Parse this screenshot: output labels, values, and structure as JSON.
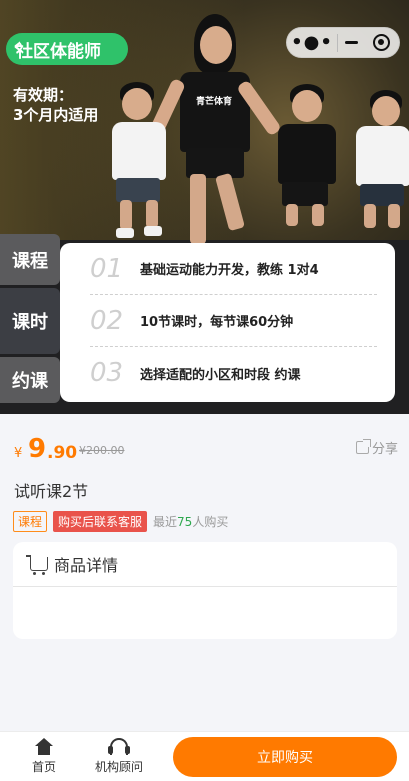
{
  "header": {
    "title": "社区体能师",
    "validity_line1": "有效期：",
    "validity_line2": "3个月内适用",
    "shirt_logo": "青芒体育"
  },
  "capsule": {
    "more_icon": "more-dots-icon",
    "minimize_icon": "minimize-icon",
    "close_icon": "target-close-icon"
  },
  "side_tabs": [
    "课程",
    "课时",
    "约课"
  ],
  "steps": [
    {
      "num": "01",
      "text": "基础运动能力开发，教练 1对4"
    },
    {
      "num": "02",
      "text": "10节课时，每节课60分钟"
    },
    {
      "num": "03",
      "text": "选择适配的小区和时段 约课"
    }
  ],
  "price": {
    "currency": "¥",
    "integer": "9",
    "decimal": ".90",
    "original": "¥200.00"
  },
  "share_label": "分享",
  "course_title": "试听课2节",
  "tags": {
    "category": "课程",
    "service": "购买后联系客服"
  },
  "purchase_stats": {
    "prefix": "最近",
    "count": "75",
    "suffix": "人购买"
  },
  "detail": {
    "title": "商品详情"
  },
  "bottom_nav": {
    "home": "首页",
    "consultant": "机构顾问",
    "buy": "立即购买"
  },
  "colors": {
    "accent": "#ff7a00",
    "title_pill": "#2fc26a",
    "service_tag": "#e9534b",
    "count_green": "#2fa84f"
  }
}
